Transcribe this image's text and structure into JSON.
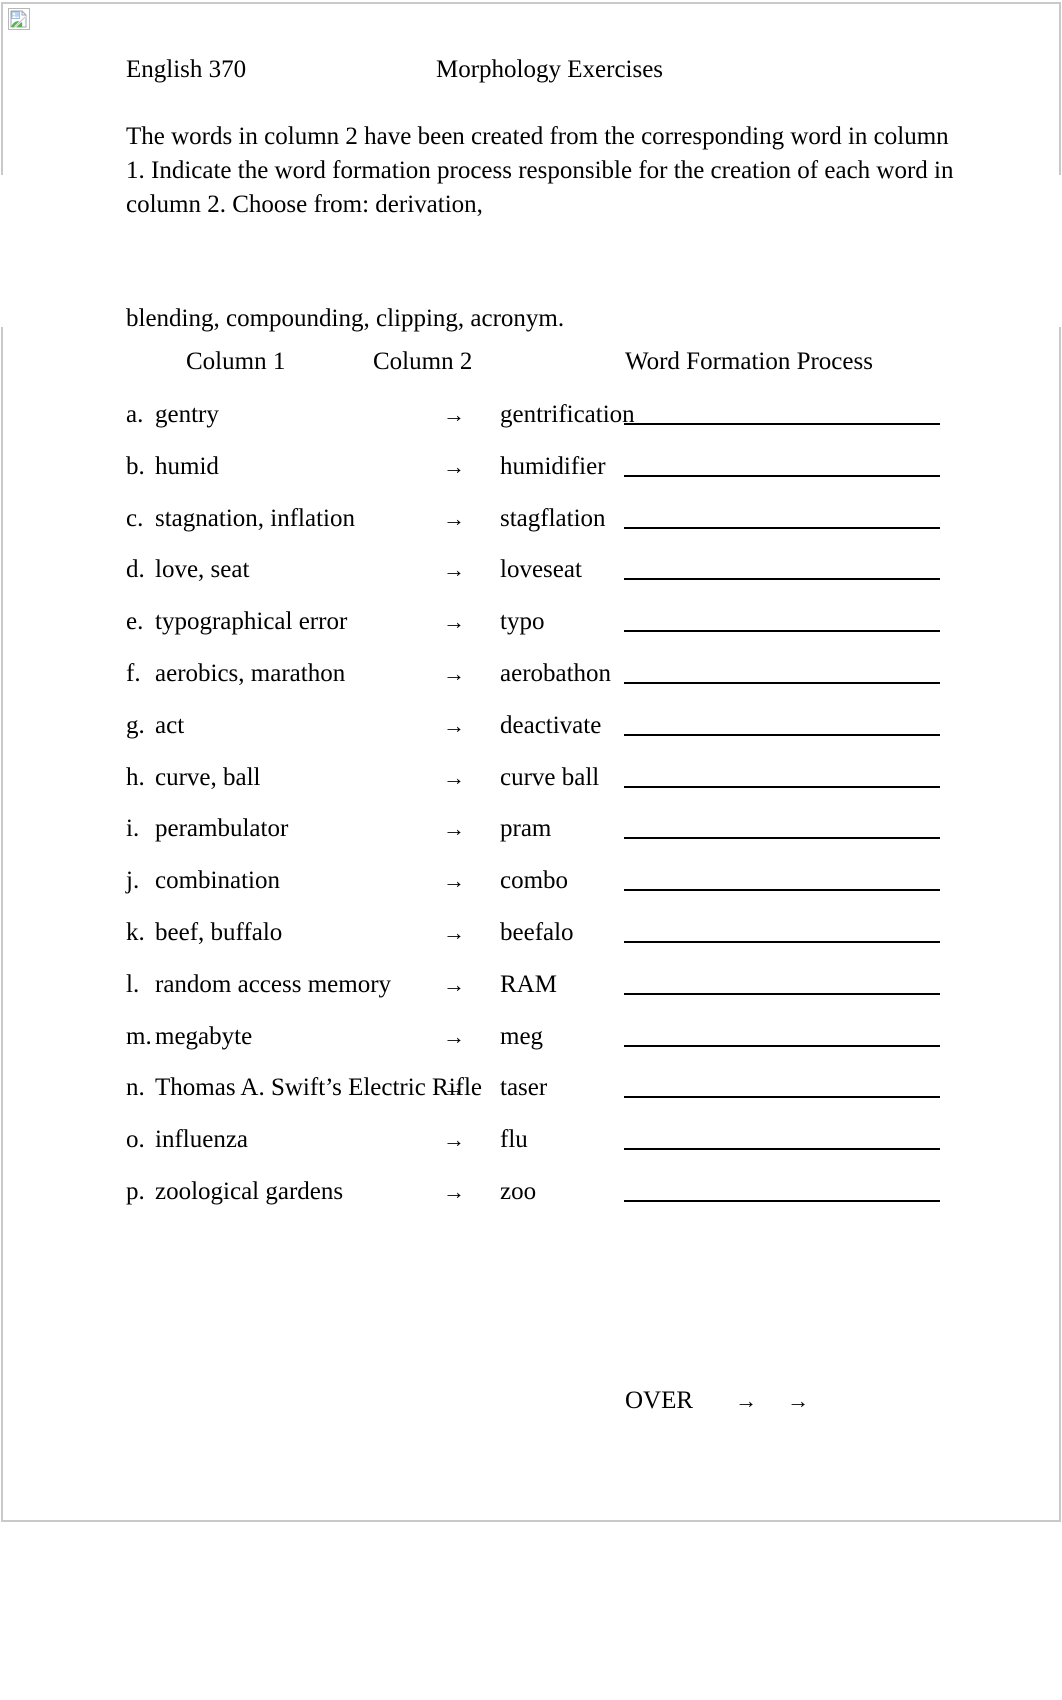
{
  "document": {
    "icon": "broken-image-icon",
    "header": {
      "course": "English 370",
      "title": "Morphology Exercises"
    },
    "instructions": {
      "body": "The words in column 2 have been created from the corresponding word in column 1. Indicate the word formation process responsible for the creation of each word in column 2. Choose from: derivation,",
      "tail": "blending, compounding, clipping, acronym."
    },
    "columns": {
      "col1": "Column 1",
      "col2": "Column 2",
      "col3": "Word Formation Process"
    },
    "arrow_glyph": "→",
    "rows": [
      {
        "marker": "a.",
        "source": "gentry",
        "arrow": "→",
        "result": "gentrification",
        "answer": ""
      },
      {
        "marker": "b.",
        "source": "humid",
        "arrow": "→",
        "result": "humidifier",
        "answer": ""
      },
      {
        "marker": "c.",
        "source": "stagnation, inflation",
        "arrow": "→",
        "result": "stagflation",
        "answer": ""
      },
      {
        "marker": "d.",
        "source": "love, seat",
        "arrow": "→",
        "result": "loveseat",
        "answer": ""
      },
      {
        "marker": "e.",
        "source": "typographical error",
        "arrow": "→",
        "result": "typo",
        "answer": ""
      },
      {
        "marker": "f.",
        "source": "aerobics, marathon",
        "arrow": "→",
        "result": "aerobathon",
        "answer": ""
      },
      {
        "marker": "g.",
        "source": "act",
        "arrow": "→",
        "result": "deactivate",
        "answer": ""
      },
      {
        "marker": "h.",
        "source": "curve, ball",
        "arrow": "→",
        "result": "curve ball",
        "answer": ""
      },
      {
        "marker": "i.",
        "source": "perambulator",
        "arrow": "→",
        "result": "pram",
        "answer": ""
      },
      {
        "marker": "j.",
        "source": "combination",
        "arrow": "→",
        "result": "combo",
        "answer": ""
      },
      {
        "marker": "k.",
        "source": "beef, buffalo",
        "arrow": "→",
        "result": "beefalo",
        "answer": ""
      },
      {
        "marker": "l.",
        "source": "random access memory",
        "arrow": "→",
        "result": "RAM",
        "answer": ""
      },
      {
        "marker": "m.",
        "source": "megabyte",
        "arrow": "→",
        "result": "meg",
        "answer": ""
      },
      {
        "marker": "n.",
        "source": "Thomas A. Swift’s Electric Rifle",
        "arrow": "→",
        "result": "taser",
        "answer": ""
      },
      {
        "marker": "o.",
        "source": "influenza",
        "arrow": "→",
        "result": "flu",
        "answer": ""
      },
      {
        "marker": "p.",
        "source": "zoological gardens",
        "arrow": "→",
        "result": "zoo",
        "answer": ""
      }
    ],
    "footer": {
      "over_label": "OVER",
      "arrow_1": "→",
      "arrow_2": "→"
    }
  },
  "colors": {
    "page_border": "#c9c9c9",
    "text": "#000000",
    "rule": "#000000",
    "page_background": "#ffffff"
  }
}
